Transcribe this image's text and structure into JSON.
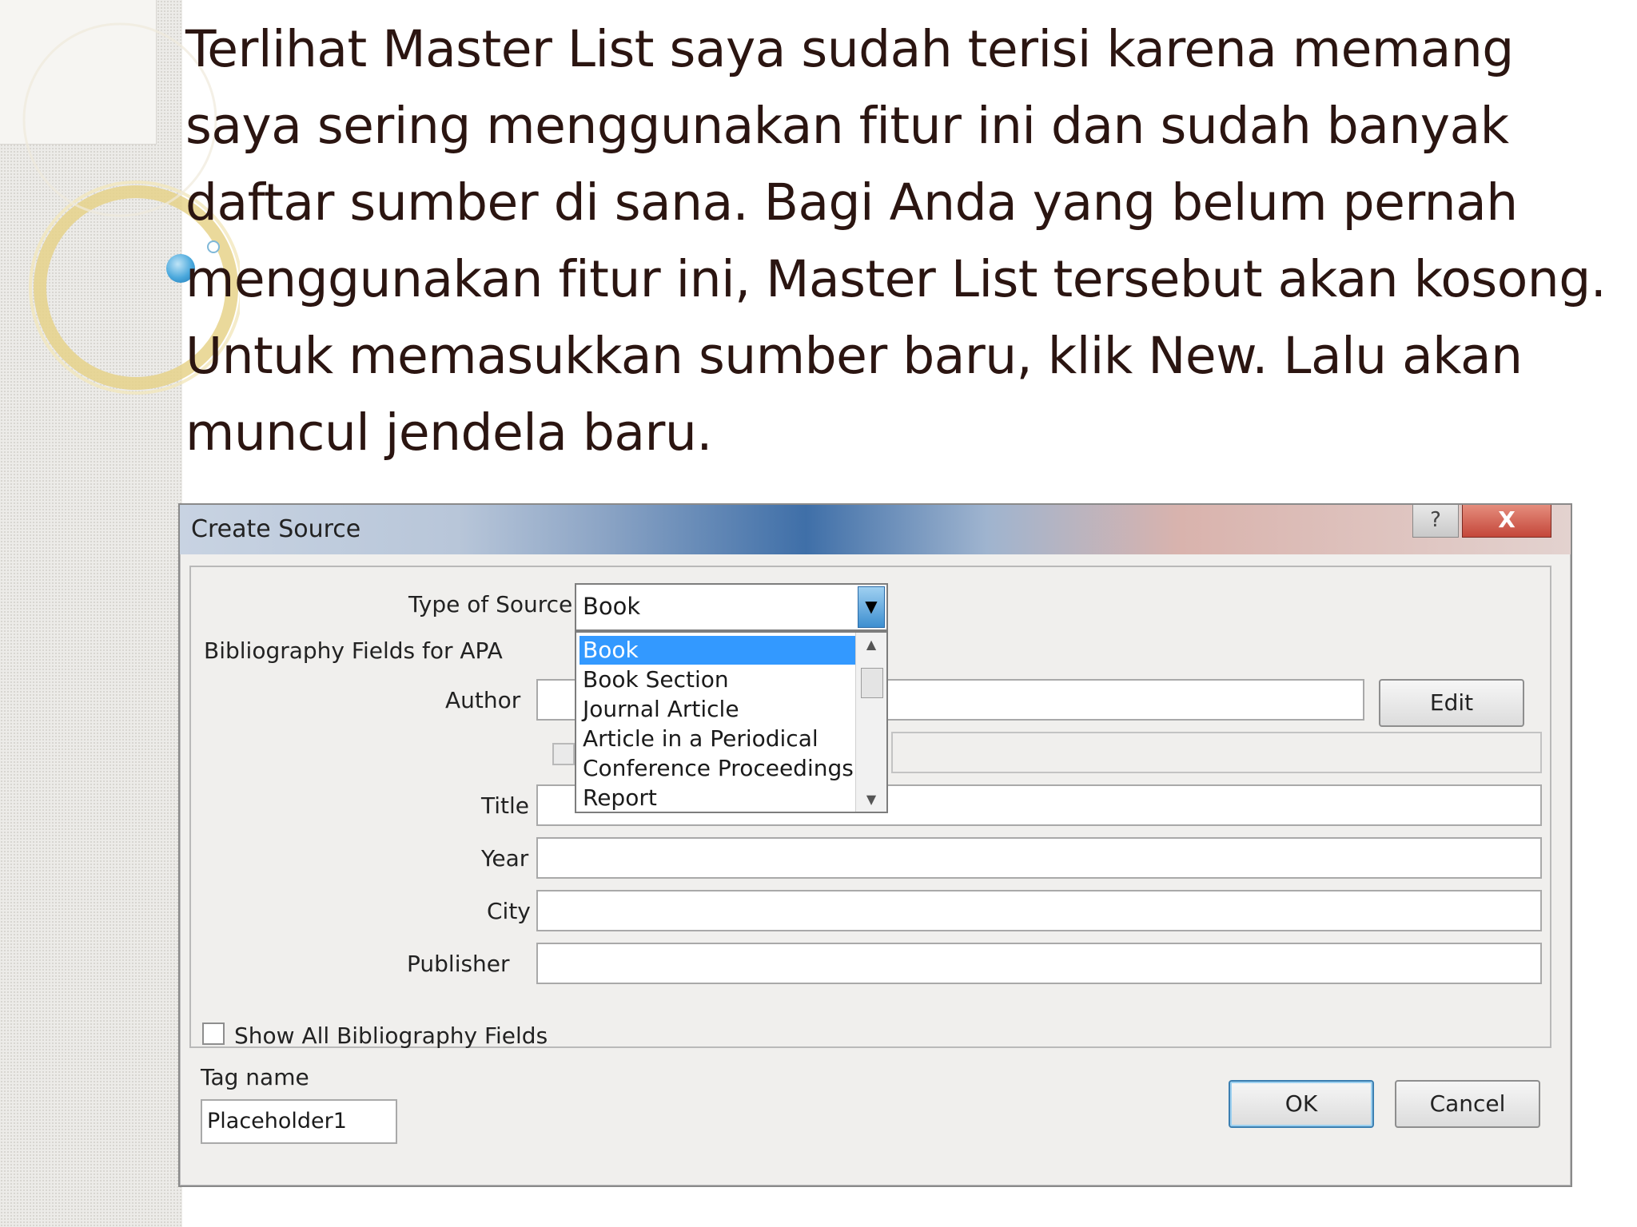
{
  "slide": {
    "paragraph": "Terlihat Master List saya sudah terisi karena memang saya sering menggunakan fitur ini dan sudah banyak daftar sumber di sana. Bagi Anda yang belum pernah menggunakan fitur ini, Master List tersebut akan kosong. Untuk memasukkan sumber baru, klik New. Lalu akan muncul jendela baru."
  },
  "dialog": {
    "title": "Create Source",
    "help_glyph": "?",
    "close_glyph": "X",
    "type_of_source_label": "Type of Source",
    "type_of_source_value": "Book",
    "bibliography_fields_label": "Bibliography Fields for APA",
    "source_types": [
      "Book",
      "Book Section",
      "Journal Article",
      "Article in a Periodical",
      "Conference Proceedings",
      "Report"
    ],
    "fields": {
      "author_label": "Author",
      "title_label": "Title",
      "year_label": "Year",
      "city_label": "City",
      "publisher_label": "Publisher"
    },
    "edit_button": "Edit",
    "show_all_label": "Show All Bibliography Fields",
    "tag_name_label": "Tag name",
    "tag_name_value": "Placeholder1",
    "ok_button": "OK",
    "cancel_button": "Cancel"
  },
  "icons": {
    "dropdown_arrow": "chevron-down-icon",
    "scroll_up": "scroll-up-icon",
    "scroll_down": "scroll-down-icon"
  }
}
